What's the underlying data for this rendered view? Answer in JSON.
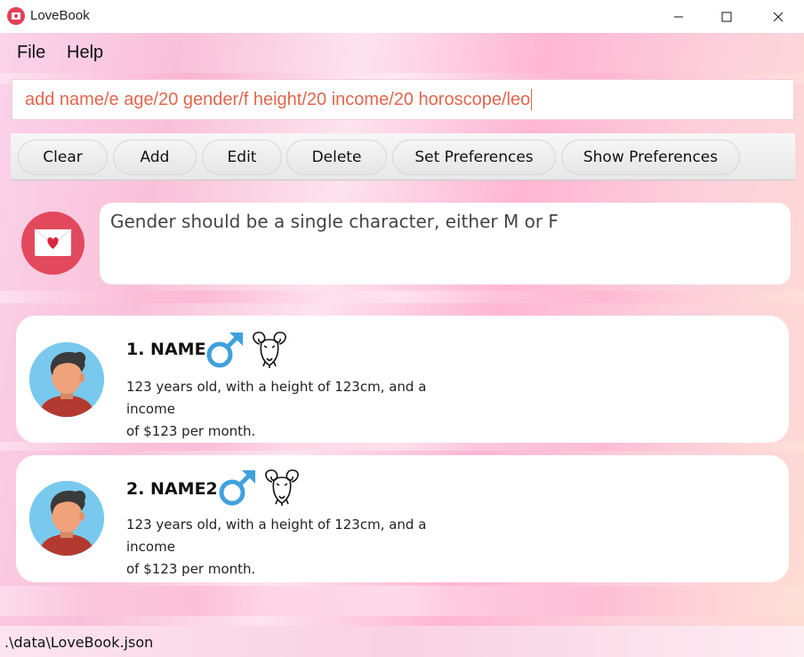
{
  "window": {
    "title": "LoveBook",
    "minimize_glyph": "—",
    "maximize_glyph": "☐",
    "close_glyph": "✕"
  },
  "menu": {
    "items": [
      {
        "label": "File"
      },
      {
        "label": "Help"
      }
    ]
  },
  "command": {
    "value": "add name/e age/20 gender/f height/20 income/20 horoscope/leo"
  },
  "toolbar": {
    "buttons": [
      {
        "label": "Clear"
      },
      {
        "label": "Add"
      },
      {
        "label": "Edit"
      },
      {
        "label": "Delete"
      },
      {
        "label": "Set Preferences"
      },
      {
        "label": "Show Preferences"
      }
    ]
  },
  "result": {
    "icon": "envelope-heart-icon",
    "message": "Gender should be a single character, either M or F"
  },
  "people": [
    {
      "name": "1.  NAME",
      "gender_icon": "male-icon",
      "horoscope_icon": "aries-ram-icon",
      "description_line1": "123 years old, with a height of 123cm, and a income",
      "description_line2": "of $123 per month."
    },
    {
      "name": "2.  NAME2",
      "gender_icon": "male-icon",
      "horoscope_icon": "aries-ram-icon",
      "description_line1": "123 years old, with a height of 123cm, and a income",
      "description_line2": "of $123 per month."
    }
  ],
  "status": {
    "file_path": ".\\data\\LoveBook.json"
  },
  "colors": {
    "accent": "#e3495d",
    "command_text": "#e0664f",
    "male_blue": "#3fa1dc",
    "avatar_bg": "#79c9ee"
  }
}
